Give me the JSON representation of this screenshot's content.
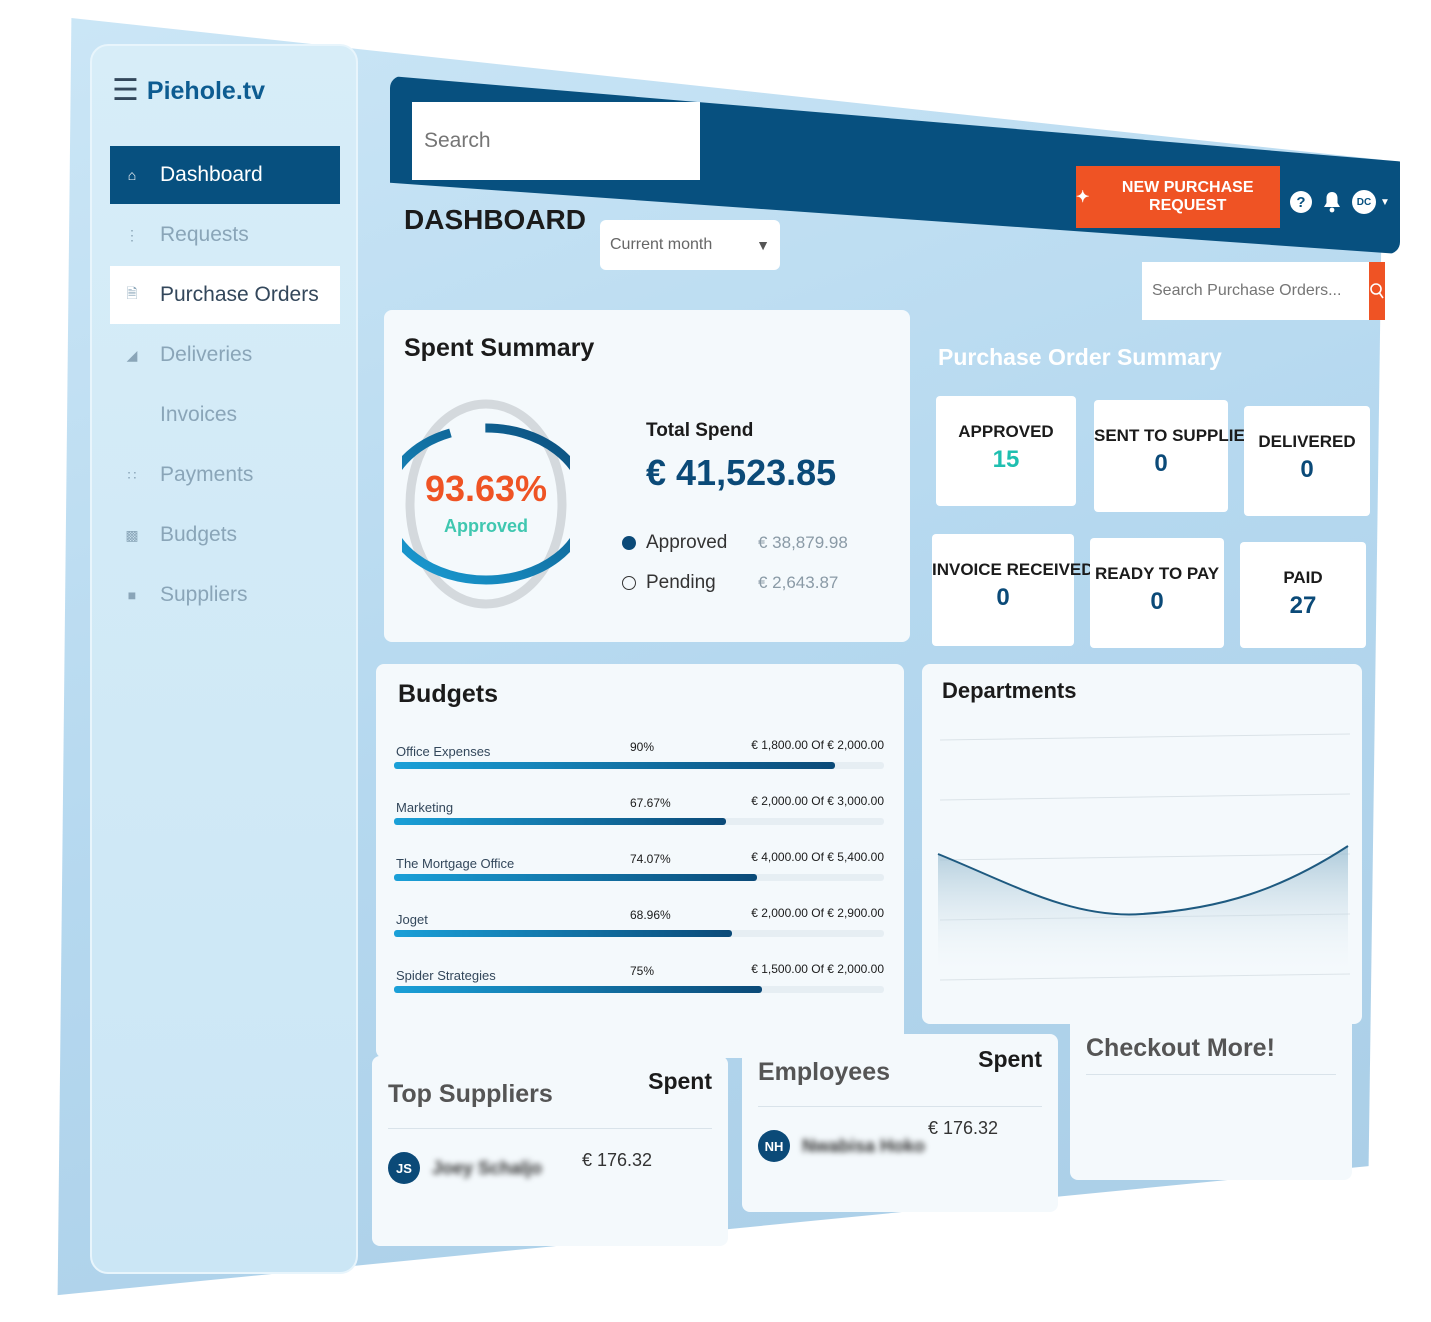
{
  "app": {
    "brand": "Piehole.tv"
  },
  "sidebar": {
    "items": [
      {
        "label": "Dashboard",
        "icon": "home-icon"
      },
      {
        "label": "Requests",
        "icon": "dots-icon"
      },
      {
        "label": "Purchase Orders",
        "icon": "document-icon"
      },
      {
        "label": "Deliveries",
        "icon": "box-icon"
      },
      {
        "label": "Invoices",
        "icon": ""
      },
      {
        "label": "Payments",
        "icon": "grid-dots-icon"
      },
      {
        "label": "Budgets",
        "icon": "wallet-icon"
      },
      {
        "label": "Suppliers",
        "icon": "truck-icon"
      }
    ]
  },
  "header": {
    "search_placeholder": "Search",
    "new_request_label": "NEW PURCHASE REQUEST",
    "help_icon": "?",
    "avatar_initials": "DC"
  },
  "dashboard": {
    "title": "DASHBOARD",
    "period": "Current month",
    "po_search_placeholder": "Search Purchase Orders..."
  },
  "spent_summary": {
    "title": "Spent Summary",
    "percent": "93.63%",
    "percent_value": 93.63,
    "percent_label": "Approved",
    "total_label": "Total Spend",
    "total_value": "€ 41,523.85",
    "approved_label": "Approved",
    "approved_value": "€ 38,879.98",
    "pending_label": "Pending",
    "pending_value": "€ 2,643.87"
  },
  "po_summary": {
    "title": "Purchase Order Summary",
    "tiles": [
      {
        "label": "APPROVED",
        "value": "15"
      },
      {
        "label": "SENT TO SUPPLIER",
        "value": "0"
      },
      {
        "label": "DELIVERED",
        "value": "0"
      },
      {
        "label": "INVOICE RECEIVED",
        "value": "0"
      },
      {
        "label": "READY TO PAY",
        "value": "0"
      },
      {
        "label": "PAID",
        "value": "27"
      }
    ]
  },
  "budgets": {
    "title": "Budgets",
    "rows": [
      {
        "name": "Office Expenses",
        "percent": "90%",
        "fraction": 0.9,
        "amount": "€ 1,800.00 Of € 2,000.00"
      },
      {
        "name": "Marketing",
        "percent": "67.67%",
        "fraction": 0.6767,
        "amount": "€ 2,000.00 Of € 3,000.00"
      },
      {
        "name": "The Mortgage Office",
        "percent": "74.07%",
        "fraction": 0.7407,
        "amount": "€ 4,000.00 Of € 5,400.00"
      },
      {
        "name": "Joget",
        "percent": "68.96%",
        "fraction": 0.6896,
        "amount": "€ 2,000.00 Of € 2,900.00"
      },
      {
        "name": "Spider Strategies",
        "percent": "75%",
        "fraction": 0.75,
        "amount": "€ 1,500.00 Of € 2,000.00"
      }
    ]
  },
  "departments": {
    "title": "Departments"
  },
  "top_suppliers": {
    "title": "Top Suppliers",
    "spent_label": "Spent",
    "rows": [
      {
        "initials": "JS",
        "name": "Joey Schaljo",
        "amount": "€ 176.32"
      }
    ]
  },
  "employees": {
    "title": "Employees",
    "spent_label": "Spent",
    "rows": [
      {
        "initials": "NH",
        "name": "Nwabisa Hoko",
        "amount": "€ 176.32"
      }
    ]
  },
  "checkout": {
    "title": "Checkout More!"
  },
  "colors": {
    "primary": "#07507f",
    "accent": "#ef5324",
    "teal": "#3fc7b0",
    "background": "#b5d8ef"
  }
}
